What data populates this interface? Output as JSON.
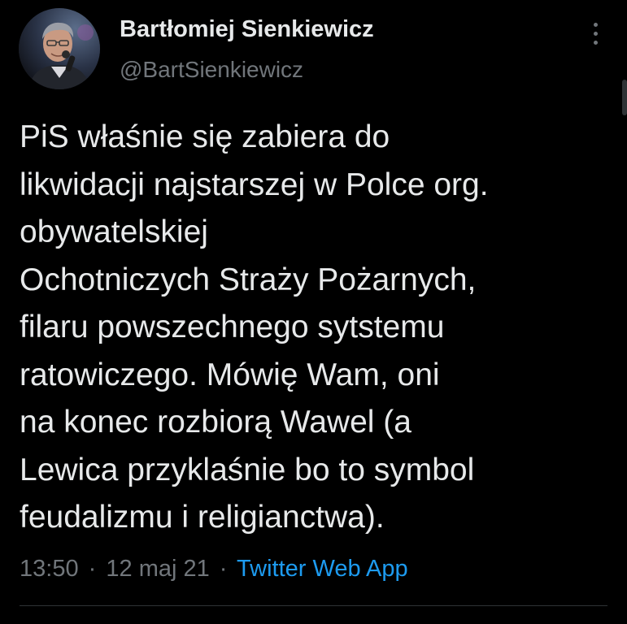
{
  "author": {
    "name": "Bartłomiej Sienkiewicz",
    "handle": "@BartSienkiewicz",
    "avatar_icon": "profile-photo"
  },
  "tweet": {
    "lines": [
      "PiS właśnie się zabiera do",
      "likwidacji najstarszej w Polce org.",
      "obywatelskiej",
      "Ochotniczych Straży Pożarnych,",
      "filaru powszechnego sytstemu",
      "ratowiczego. Mówię Wam, oni",
      "na konec rozbiorą Wawel (a",
      "Lewica przyklaśnie bo to symbol",
      "feudalizmu i religianctwa)."
    ]
  },
  "meta": {
    "time": "13:50",
    "date": "12 maj 21",
    "separator": "·",
    "source": "Twitter Web App"
  },
  "menu": {
    "icon": "more-vertical-icon"
  },
  "colors": {
    "background": "#000000",
    "text": "#e7e9ea",
    "secondary": "#71767b",
    "link": "#1d9bf0",
    "divider": "#2f3336"
  }
}
